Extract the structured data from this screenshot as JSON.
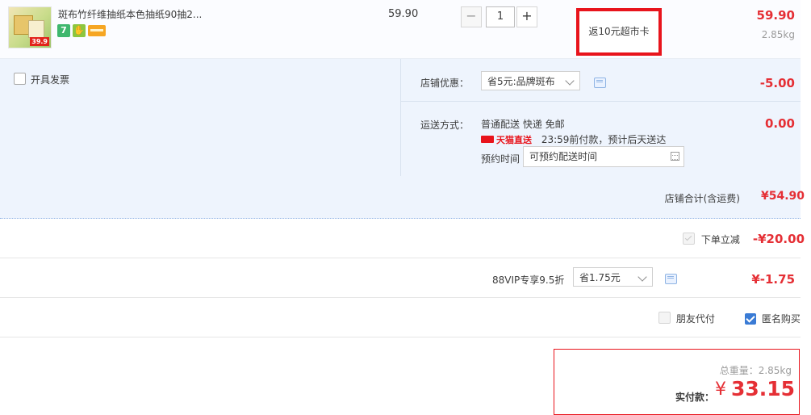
{
  "product": {
    "title": "斑布竹纤维抽纸本色抽纸90抽2...",
    "thumb_price_tag": "39.9",
    "badges": [
      "7",
      "hand-badge-icon",
      "card-badge-icon"
    ],
    "unit_price": "59.90",
    "quantity": "1",
    "minus_label": "−",
    "plus_label": "+",
    "cashback": "返10元超市卡",
    "subtotal": "59.90",
    "weight": "2.85kg"
  },
  "invoice": {
    "label": "开具发票"
  },
  "shop_discount": {
    "label": "店铺优惠：",
    "selected": "省5元:品牌斑布",
    "amount": "-5.00"
  },
  "shipping": {
    "label": "运送方式：",
    "method": "普通配送 快递 免邮",
    "tmall_tag": "天猫直送",
    "delivery_note": "23:59前付款，预计后天送达",
    "schedule_label": "预约时间",
    "schedule_placeholder": "可预约配送时间",
    "amount": "0.00"
  },
  "shop_total": {
    "label": "店铺合计(含运费)",
    "value": "¥54.90"
  },
  "instant_discount": {
    "label": "下单立减",
    "amount": "-¥20.00"
  },
  "vip": {
    "label": "88VIP专享9.5折",
    "selected": "省1.75元",
    "amount": "¥-1.75"
  },
  "options": {
    "friend_pay": "朋友代付",
    "anonymous": "匿名购买"
  },
  "summary": {
    "total_weight_label": "总重量：2.85kg",
    "pay_label": "实付款：",
    "currency": "¥",
    "amount": "33.15"
  },
  "colors": {
    "price_red": "#e52f35",
    "highlight_border": "#e8141c",
    "block_bg": "#eef4fd",
    "checkbox_blue": "#3a7bd5"
  }
}
